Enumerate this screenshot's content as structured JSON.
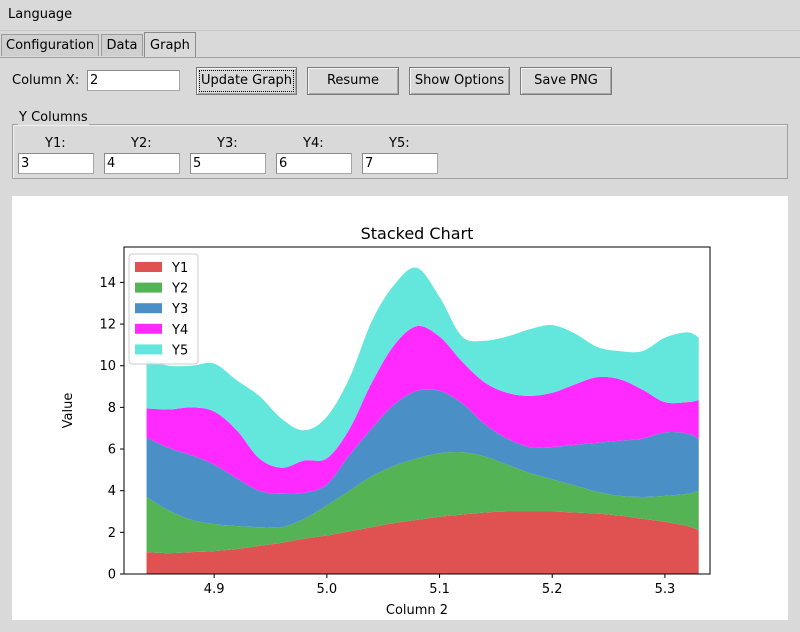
{
  "menubar": {
    "items": [
      "Language"
    ]
  },
  "tabs": [
    {
      "label": "Configuration",
      "active": false
    },
    {
      "label": "Data",
      "active": false
    },
    {
      "label": "Graph",
      "active": true
    }
  ],
  "controls": {
    "column_x_label": "Column X:",
    "column_x_value": "2",
    "update_graph_label": "Update Graph",
    "resume_label": "Resume",
    "show_options_label": "Show Options",
    "save_png_label": "Save PNG"
  },
  "y_columns": {
    "title": "Y Columns",
    "fields": [
      {
        "label": "Y1:",
        "value": "3"
      },
      {
        "label": "Y2:",
        "value": "4"
      },
      {
        "label": "Y3:",
        "value": "5"
      },
      {
        "label": "Y4:",
        "value": "6"
      },
      {
        "label": "Y5:",
        "value": "7"
      }
    ]
  },
  "chart_data": {
    "type": "area",
    "stacked": true,
    "title": "Stacked Chart",
    "xlabel": "Column 2",
    "ylabel": "Value",
    "xlim": [
      4.82,
      5.34
    ],
    "ylim": [
      0,
      15.7
    ],
    "xticks": [
      "4.9",
      "5.0",
      "5.1",
      "5.2",
      "5.3"
    ],
    "xtick_values": [
      4.9,
      5.0,
      5.1,
      5.2,
      5.3
    ],
    "yticks": [
      0,
      2,
      4,
      6,
      8,
      10,
      12,
      14
    ],
    "legend_position": "top-left",
    "x": [
      4.84,
      4.86,
      4.88,
      4.9,
      4.92,
      4.94,
      4.96,
      4.98,
      5.0,
      5.02,
      5.04,
      5.06,
      5.08,
      5.1,
      5.12,
      5.14,
      5.16,
      5.18,
      5.2,
      5.22,
      5.24,
      5.26,
      5.28,
      5.3,
      5.32,
      5.33
    ],
    "series": [
      {
        "name": "Y1",
        "color": "#e05252",
        "values": [
          1.05,
          1.0,
          1.05,
          1.1,
          1.2,
          1.35,
          1.5,
          1.7,
          1.85,
          2.05,
          2.25,
          2.45,
          2.6,
          2.75,
          2.85,
          2.95,
          3.0,
          3.0,
          3.0,
          2.95,
          2.9,
          2.8,
          2.65,
          2.5,
          2.3,
          2.1
        ]
      },
      {
        "name": "Y2",
        "color": "#54b354",
        "values": [
          2.65,
          2.05,
          1.55,
          1.3,
          1.1,
          0.9,
          0.75,
          0.95,
          1.45,
          1.95,
          2.45,
          2.75,
          2.95,
          3.05,
          3.0,
          2.7,
          2.25,
          1.85,
          1.55,
          1.3,
          1.05,
          0.95,
          1.05,
          1.25,
          1.55,
          1.9
        ]
      },
      {
        "name": "Y3",
        "color": "#4a90c6",
        "values": [
          2.85,
          3.0,
          3.1,
          2.85,
          2.3,
          1.75,
          1.6,
          1.25,
          1.0,
          1.7,
          2.3,
          2.95,
          3.25,
          3.0,
          2.35,
          1.55,
          1.25,
          1.25,
          1.55,
          1.95,
          2.35,
          2.65,
          2.8,
          3.05,
          2.9,
          2.5
        ]
      },
      {
        "name": "Y4",
        "color": "#ff2aff",
        "values": [
          1.4,
          1.85,
          2.3,
          2.55,
          2.3,
          1.55,
          1.25,
          1.55,
          1.25,
          1.25,
          2.2,
          2.85,
          3.1,
          2.6,
          2.0,
          2.0,
          2.2,
          2.45,
          2.6,
          2.9,
          3.15,
          2.95,
          2.35,
          1.45,
          1.5,
          1.85
        ]
      },
      {
        "name": "Y5",
        "color": "#63e6db",
        "values": [
          2.3,
          2.1,
          2.0,
          2.3,
          2.4,
          3.0,
          2.35,
          1.45,
          2.0,
          2.45,
          2.95,
          2.9,
          2.8,
          1.9,
          1.2,
          2.0,
          2.7,
          3.2,
          3.25,
          2.45,
          1.45,
          1.35,
          1.85,
          3.1,
          3.35,
          3.0
        ]
      }
    ]
  }
}
